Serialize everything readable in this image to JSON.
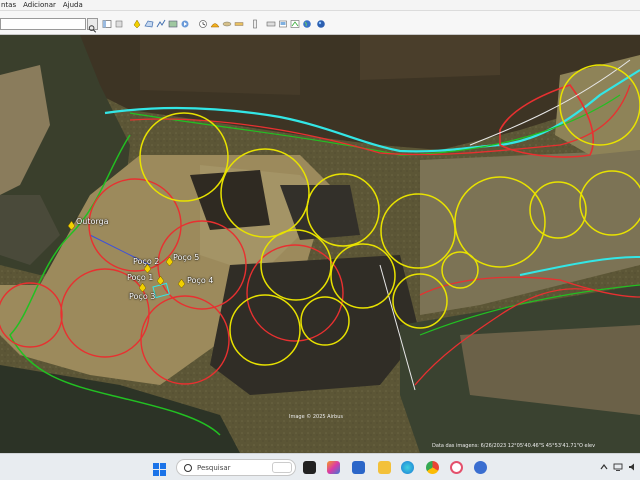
{
  "menubar": {
    "items": [
      "ntas",
      "Adicionar",
      "Ajuda"
    ]
  },
  "toolbar": {
    "search_value": "",
    "icons": [
      "search-icon",
      "hand-icon",
      "placemark-icon",
      "polygon-icon",
      "path-icon",
      "overlay-icon",
      "tour-icon",
      "history-icon",
      "sun-icon",
      "planets-icon",
      "ruler-icon",
      "email-icon",
      "print-icon",
      "save-image-icon",
      "maps-icon",
      "earth-icon"
    ]
  },
  "map": {
    "placemarks": [
      {
        "name": "Outorga"
      },
      {
        "name": "Poço 2"
      },
      {
        "name": "Poço 5"
      },
      {
        "name": "Poço 1"
      },
      {
        "name": "Poço 4"
      },
      {
        "name": "Poço 3"
      }
    ],
    "attribution": "Image © 2025 Airbus",
    "status_bar": "Data das imagens: 6/26/2023   12°05'40.46\"S  45°53'41.71\"O  elev"
  },
  "taskbar": {
    "search_placeholder": "Pesquisar",
    "colors": {
      "yellow_circle": "#e8e200",
      "red_circle": "#e83030",
      "cyan_line": "#33e6e6",
      "green_line": "#22c022"
    }
  }
}
